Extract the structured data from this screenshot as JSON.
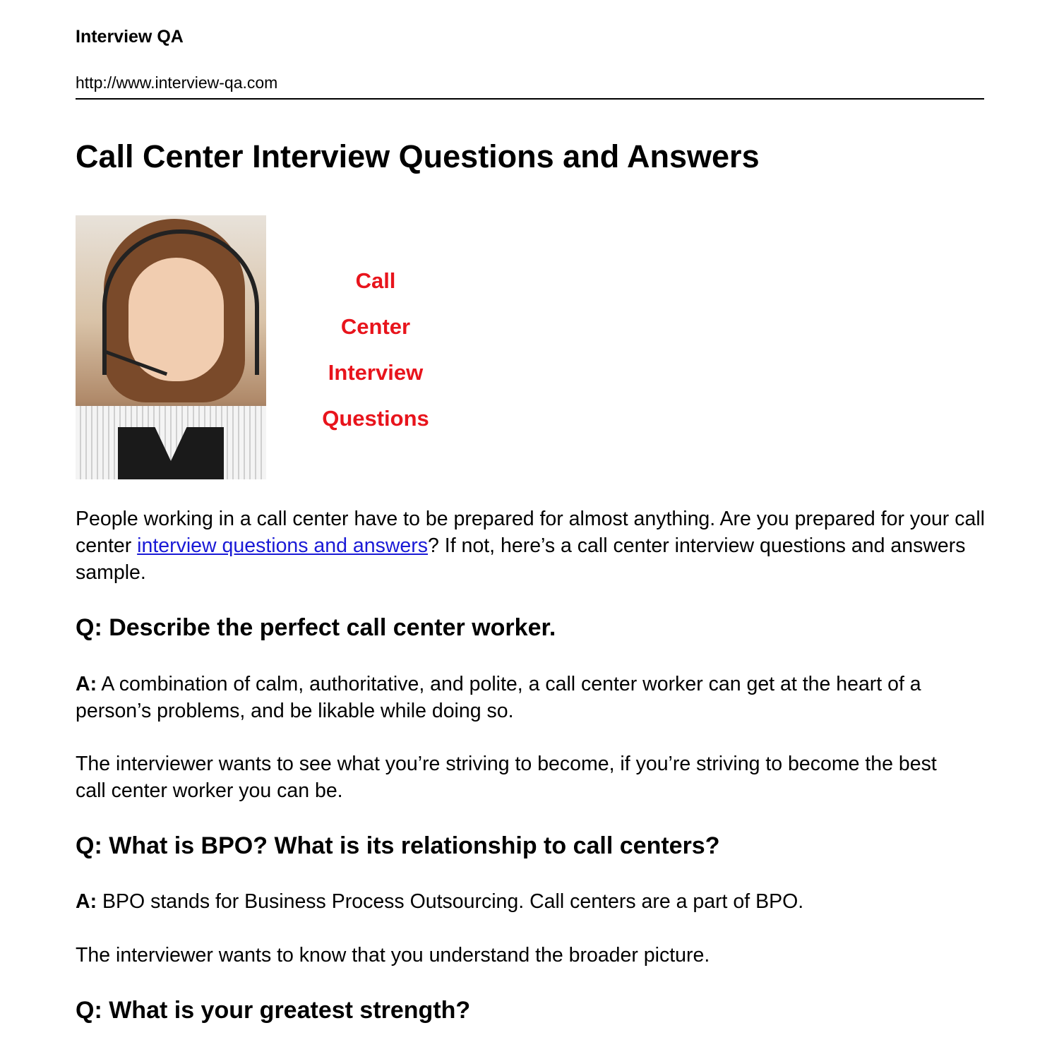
{
  "header": {
    "site_name": "Interview QA",
    "site_url": "http://www.interview-qa.com"
  },
  "title": "Call Center Interview Questions and Answers",
  "hero": {
    "image_alt": "Woman wearing a call center headset",
    "words": [
      "Call",
      "Center",
      "Interview",
      "Questions"
    ],
    "word_color": "#e8141c"
  },
  "intro": {
    "before_link": "People working in a call center have to be prepared for almost anything. Are you prepared for your call center ",
    "link_text": "interview questions and answers",
    "after_link": "? If not, here’s a call center interview questions and answers sample."
  },
  "qa": [
    {
      "question": "Q: Describe the perfect call center worker.",
      "answer_label": "A:",
      "answer": " A combination of calm, authoritative, and polite, a call center worker can get at the heart of a person’s problems, and be likable while doing so.",
      "note": "The interviewer wants to see what you’re striving to become, if you’re striving to become the best call center worker you can be."
    },
    {
      "question": "Q: What is BPO? What is its relationship to call centers?",
      "answer_label": "A:",
      "answer": " BPO stands for Business Process Outsourcing. Call centers are a part of BPO.",
      "note": "The interviewer wants to know that you understand the broader picture."
    },
    {
      "question": "Q: What is your greatest strength?"
    }
  ],
  "colors": {
    "link": "#1a1ad6",
    "text": "#000000"
  }
}
